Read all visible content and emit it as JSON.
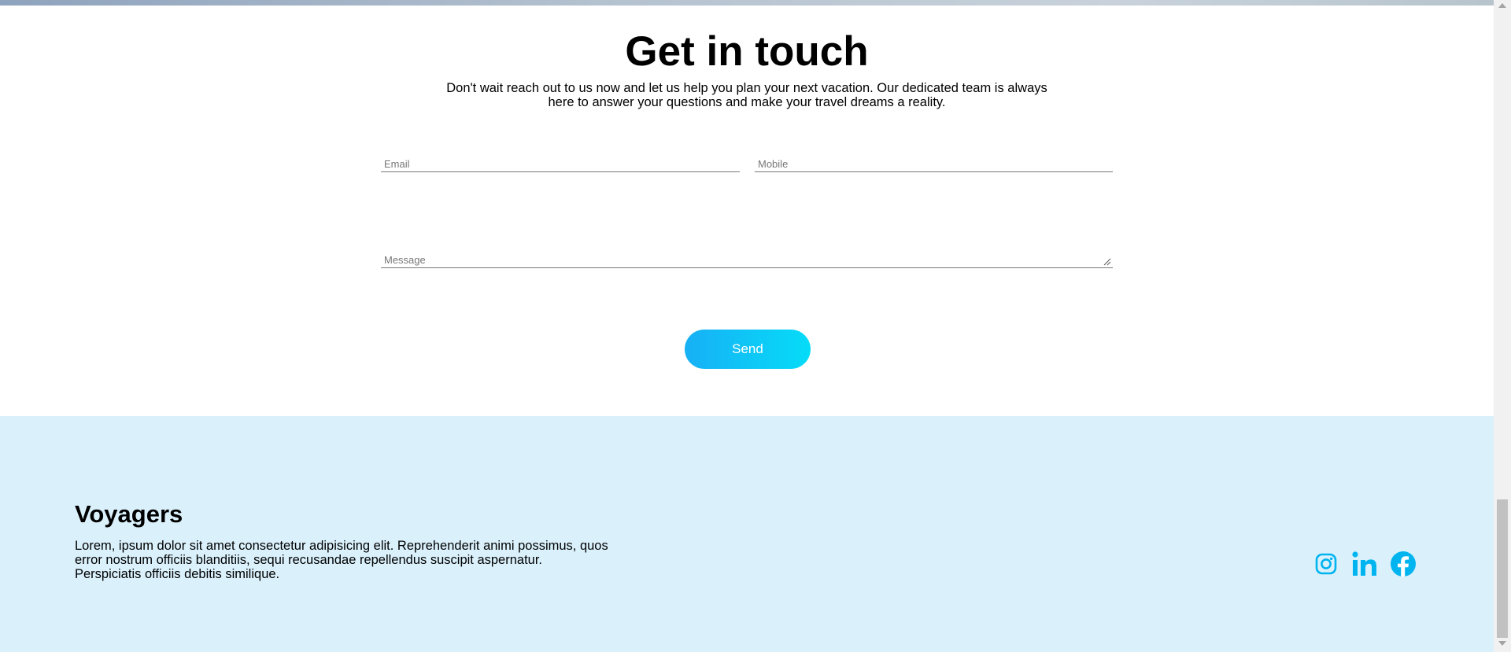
{
  "contact": {
    "title": "Get in touch",
    "subtitle": "Don't wait reach out to us now and let us help you plan your next vacation. Our dedicated team is always here to answer your questions and make your travel dreams a reality.",
    "email_placeholder": "Email",
    "mobile_placeholder": "Mobile",
    "message_placeholder": "Message",
    "send_label": "Send"
  },
  "footer": {
    "brand": "Voyagers",
    "about": "Lorem, ipsum dolor sit amet consectetur adipisicing elit. Reprehenderit animi possimus, quos error nostrum officiis blanditiis, sequi recusandae repellendus suscipit aspernatur. Perspiciatis officiis debitis similique.",
    "socials": [
      {
        "name": "instagram-icon"
      },
      {
        "name": "linkedin-icon"
      },
      {
        "name": "facebook-icon"
      }
    ]
  },
  "colors": {
    "accent": "#00b4f0",
    "button_start": "#17b0f5",
    "button_end": "#06dcf8",
    "footer_bg": "#daf1fc"
  }
}
